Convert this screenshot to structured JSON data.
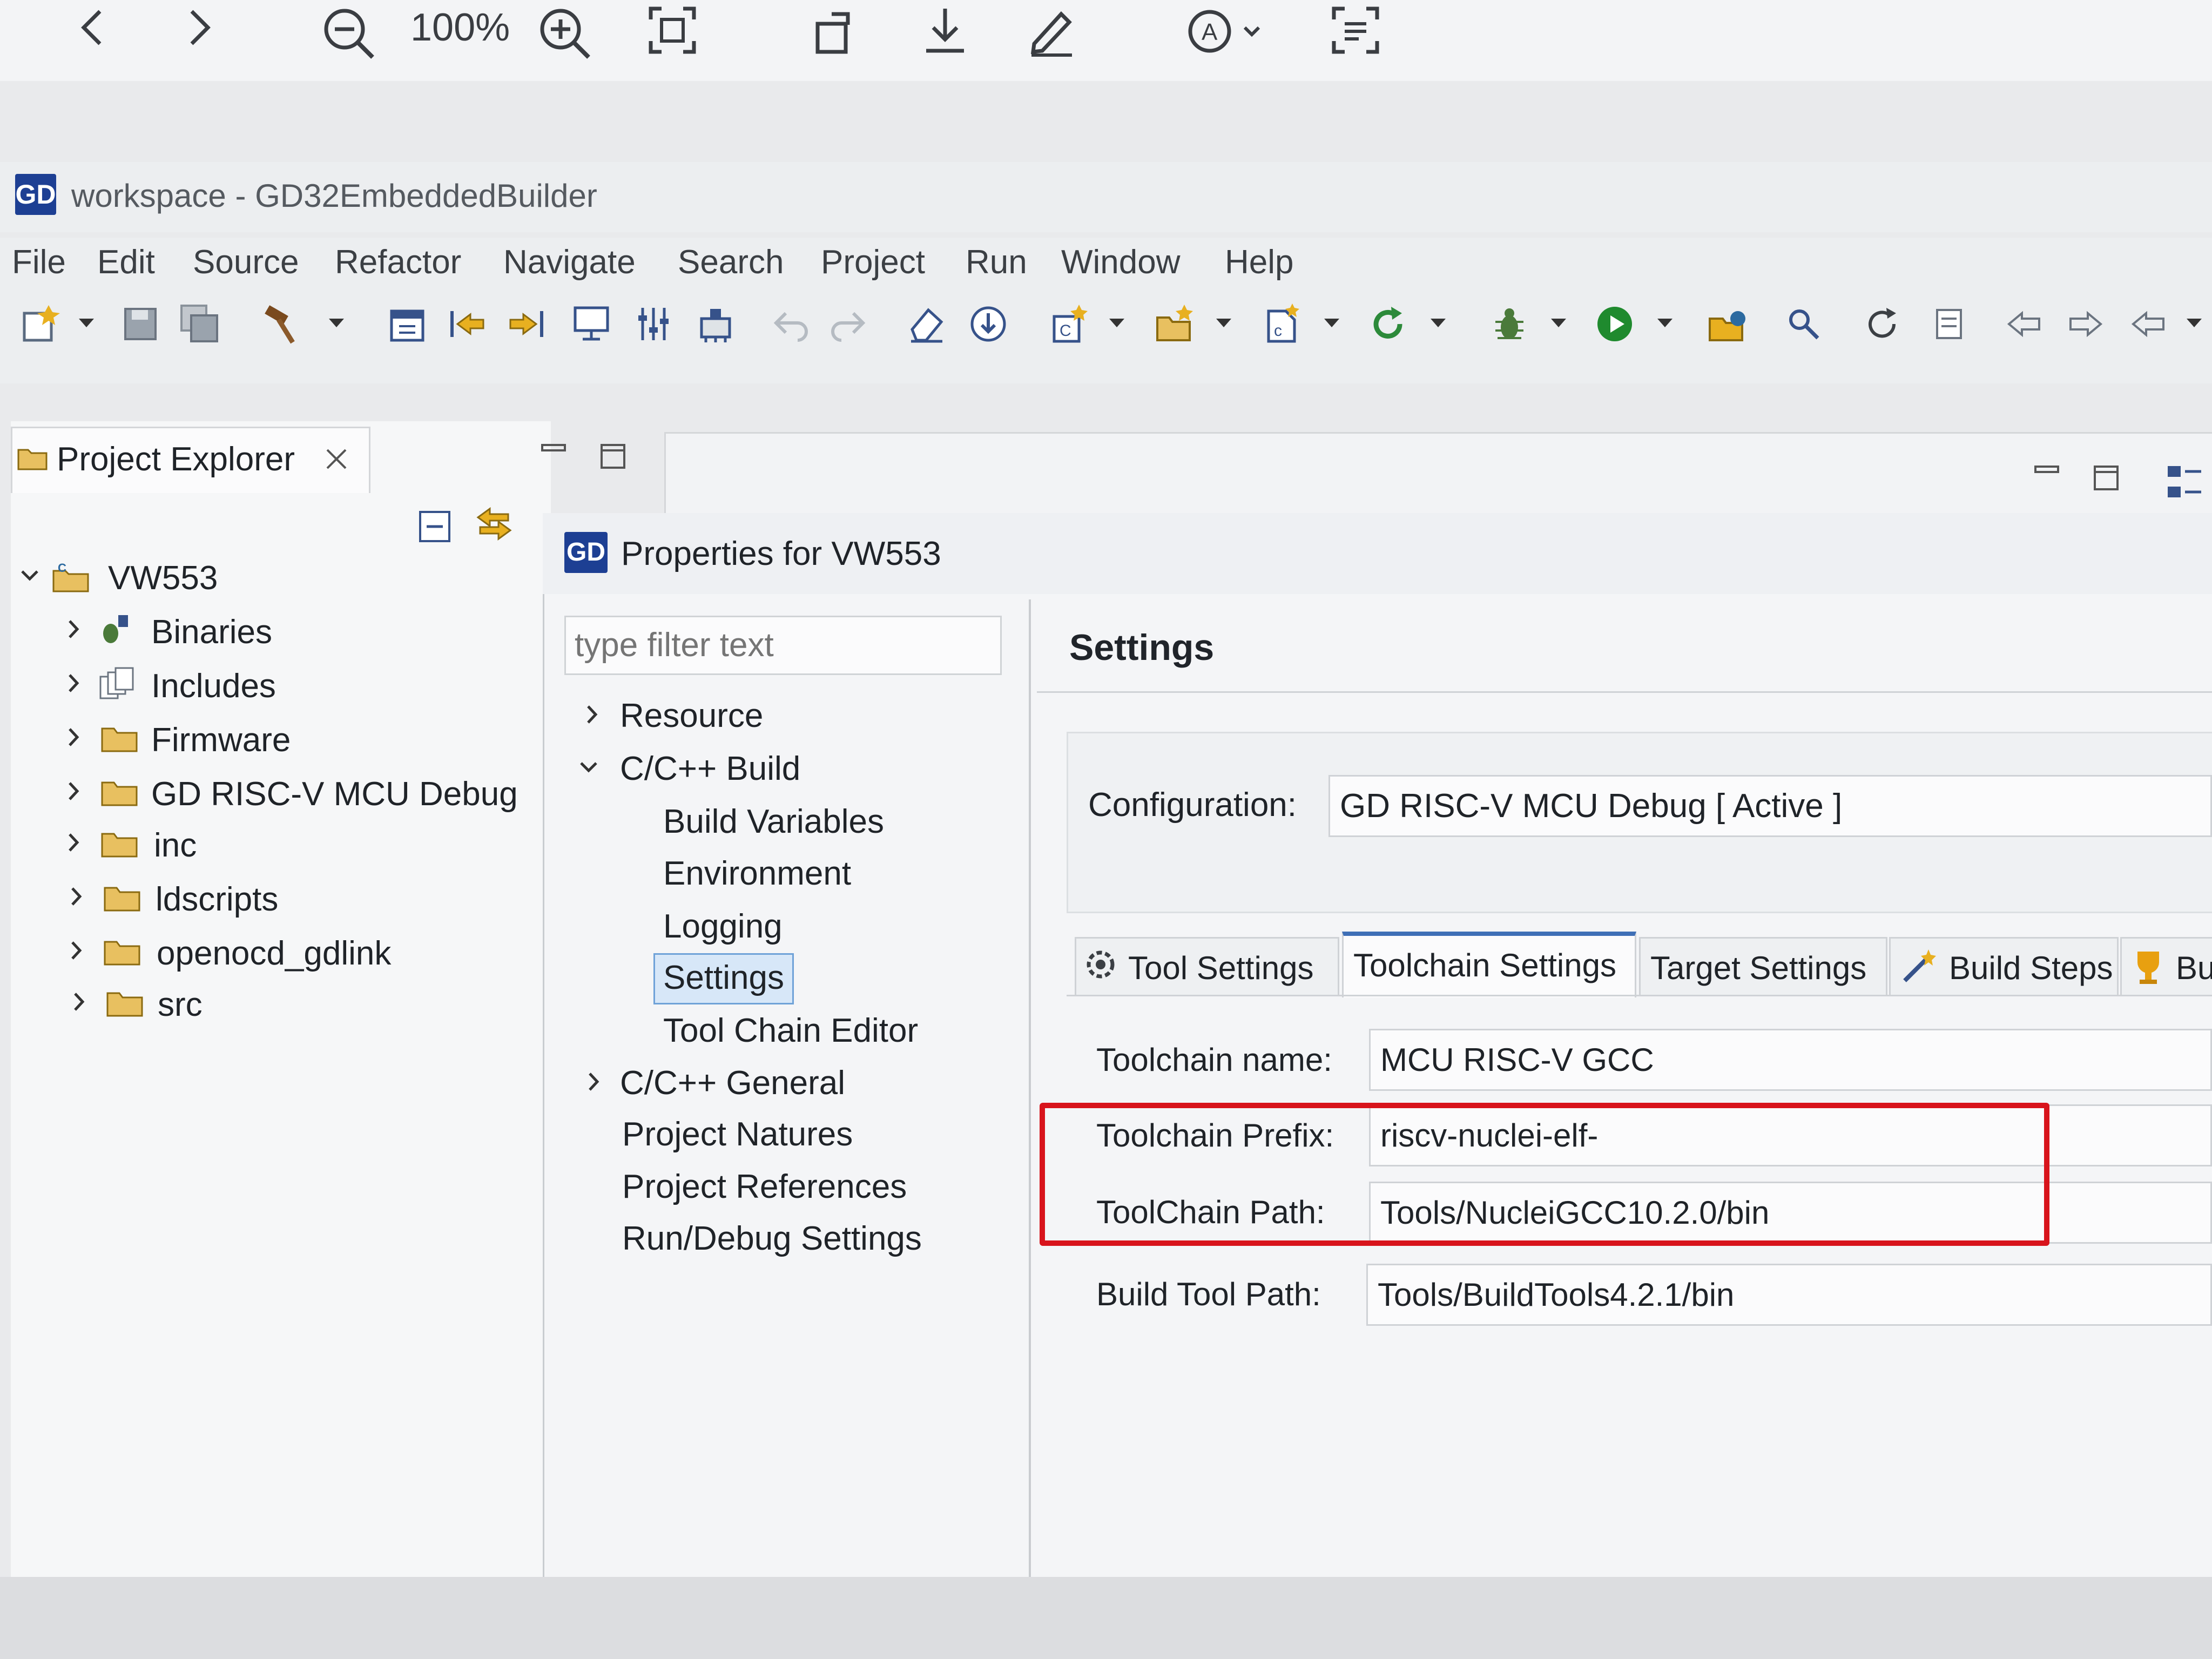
{
  "viewer": {
    "zoom": "100%"
  },
  "window": {
    "title": "workspace - GD32EmbeddedBuilder",
    "logo": "GD"
  },
  "menu": [
    "File",
    "Edit",
    "Source",
    "Refactor",
    "Navigate",
    "Search",
    "Project",
    "Run",
    "Window",
    "Help"
  ],
  "project_explorer": {
    "tab_label": "Project Explorer",
    "root": "VW553",
    "items": [
      "Binaries",
      "Includes",
      "Firmware",
      "GD RISC-V MCU Debug",
      "inc",
      "ldscripts",
      "openocd_gdlink",
      "src"
    ]
  },
  "dialog": {
    "title": "Properties for VW553",
    "logo": "GD",
    "filter_placeholder": "type filter text",
    "nav": {
      "resource": "Resource",
      "cpp_build": "C/C++ Build",
      "build_variables": "Build Variables",
      "environment": "Environment",
      "logging": "Logging",
      "settings": "Settings",
      "tool_chain_editor": "Tool Chain Editor",
      "cpp_general": "C/C++ General",
      "project_natures": "Project Natures",
      "project_references": "Project References",
      "run_debug_settings": "Run/Debug Settings"
    },
    "page_title": "Settings",
    "configuration_label": "Configuration:",
    "configuration_value": "GD RISC-V MCU Debug  [ Active ]",
    "tabs": [
      "Tool Settings",
      "Toolchain Settings",
      "Target Settings",
      "Build Steps",
      "Bu"
    ],
    "fields": {
      "toolchain_name_label": "Toolchain name:",
      "toolchain_name_value": "MCU RISC-V GCC",
      "toolchain_prefix_label": "Toolchain Prefix:",
      "toolchain_prefix_value": "riscv-nuclei-elf-",
      "toolchain_path_label": "ToolChain Path:",
      "toolchain_path_value": "Tools/NucleiGCC10.2.0/bin",
      "build_tool_path_label": "Build Tool Path:",
      "build_tool_path_value": "Tools/BuildTools4.2.1/bin"
    }
  },
  "colors": {
    "highlight": "#d8141c",
    "brand": "#1d3f93",
    "selection": "#d7e7f8"
  }
}
